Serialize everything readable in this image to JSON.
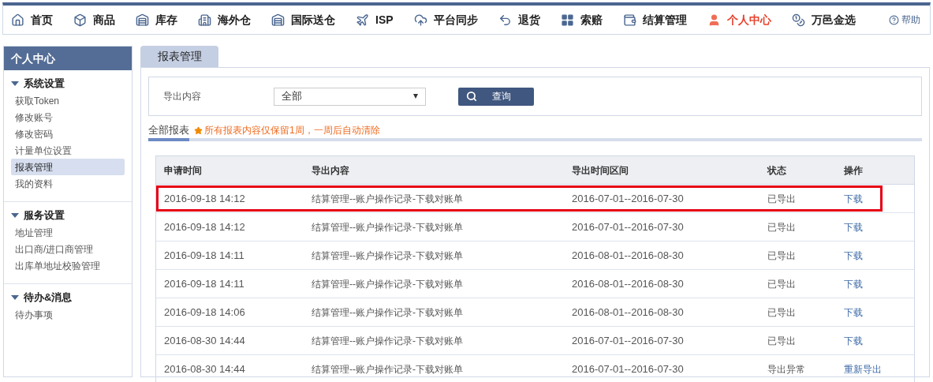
{
  "nav": {
    "items": [
      {
        "label": "首页",
        "selected": false
      },
      {
        "label": "商品",
        "selected": false
      },
      {
        "label": "库存",
        "selected": false
      },
      {
        "label": "海外仓",
        "selected": false
      },
      {
        "label": "国际送仓",
        "selected": false
      },
      {
        "label": "ISP",
        "selected": false
      },
      {
        "label": "平台同步",
        "selected": false
      },
      {
        "label": "退货",
        "selected": false
      },
      {
        "label": "索赔",
        "selected": false
      },
      {
        "label": "结算管理",
        "selected": false
      },
      {
        "label": "个人中心",
        "selected": true
      },
      {
        "label": "万邑金选",
        "selected": false
      }
    ],
    "help": "帮助"
  },
  "sidebar": {
    "title": "个人中心",
    "groups": [
      {
        "label": "系统设置",
        "expanded": true,
        "items": [
          {
            "label": "获取Token",
            "selected": false
          },
          {
            "label": "修改账号",
            "selected": false
          },
          {
            "label": "修改密码",
            "selected": false
          },
          {
            "label": "计量单位设置",
            "selected": false
          },
          {
            "label": "报表管理",
            "selected": true
          },
          {
            "label": "我的资料",
            "selected": false
          }
        ]
      },
      {
        "label": "服务设置",
        "expanded": true,
        "items": [
          {
            "label": "地址管理",
            "selected": false
          },
          {
            "label": "出口商/进口商管理",
            "selected": false
          },
          {
            "label": "出库单地址校验管理",
            "selected": false
          }
        ]
      },
      {
        "label": "待办&消息",
        "expanded": true,
        "items": [
          {
            "label": "待办事项",
            "selected": false
          }
        ]
      }
    ]
  },
  "page_tab": "报表管理",
  "filter": {
    "label": "导出内容",
    "select_value": "全部",
    "search_button": "查询"
  },
  "report_tabs": [
    {
      "label": "全部报表",
      "selected": true
    }
  ],
  "notice": "所有报表内容仅保留1周，一周后自动清除",
  "table": {
    "columns": [
      "申请时间",
      "导出内容",
      "导出时间区间",
      "状态",
      "操作"
    ],
    "rows": [
      {
        "cells": [
          "2016-09-18 14:12",
          "结算管理--账户操作记录-下载对账单",
          "2016-07-01--2016-07-30",
          "已导出",
          "下载"
        ],
        "highlighted": true
      },
      {
        "cells": [
          "2016-09-18 14:12",
          "结算管理--账户操作记录-下载对账单",
          "2016-07-01--2016-07-30",
          "已导出",
          "下载"
        ],
        "highlighted": false
      },
      {
        "cells": [
          "2016-09-18 14:11",
          "结算管理--账户操作记录-下载对账单",
          "2016-08-01--2016-08-30",
          "已导出",
          "下载"
        ],
        "highlighted": false
      },
      {
        "cells": [
          "2016-09-18 14:11",
          "结算管理--账户操作记录-下载对账单",
          "2016-08-01--2016-08-30",
          "已导出",
          "下载"
        ],
        "highlighted": false
      },
      {
        "cells": [
          "2016-09-18 14:06",
          "结算管理--账户操作记录-下载对账单",
          "2016-08-01--2016-08-30",
          "已导出",
          "下载"
        ],
        "highlighted": false
      },
      {
        "cells": [
          "2016-08-30 14:44",
          "结算管理--账户操作记录-下载对账单",
          "2016-07-01--2016-07-30",
          "已导出",
          "下载"
        ],
        "highlighted": false
      },
      {
        "cells": [
          "2016-08-30 14:44",
          "结算管理--账户操作记录-下载对账单",
          "2016-07-01--2016-07-30",
          "导出异常",
          "重新导出"
        ],
        "highlighted": false
      }
    ]
  }
}
